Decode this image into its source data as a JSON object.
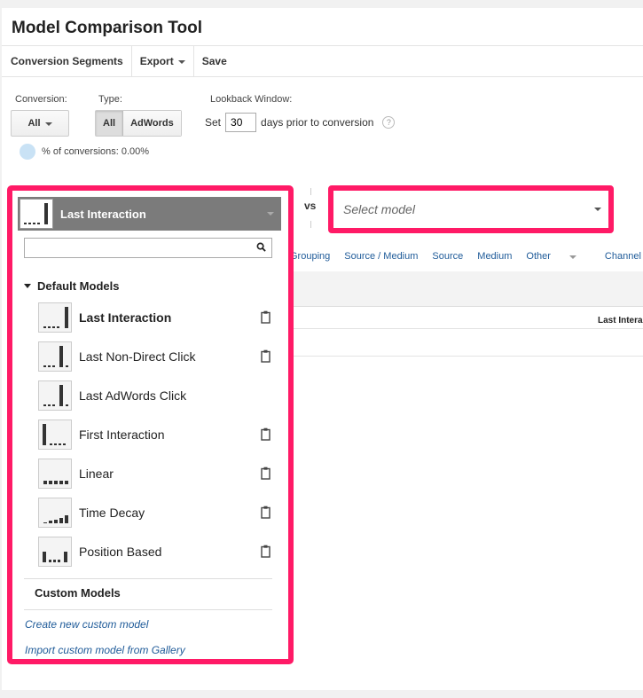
{
  "app": {
    "title": "Model Comparison Tool"
  },
  "toolbar": {
    "conversion_segments": "Conversion Segments",
    "export": "Export",
    "save": "Save"
  },
  "filters": {
    "conversion_label": "Conversion:",
    "conversion_value": "All",
    "type_label": "Type:",
    "type_all": "All",
    "type_adwords": "AdWords",
    "lookback_label": "Lookback Window:",
    "lookback_set": "Set",
    "lookback_days": "30",
    "lookback_suffix": "days prior to conversion",
    "help": "?",
    "pct_conversions": "% of conversions: 0.00%"
  },
  "compare": {
    "vs": "vs",
    "select_placeholder": "Select model"
  },
  "dimension_links": [
    "Grouping",
    "Source / Medium",
    "Source",
    "Medium",
    "Other",
    "Channel Grou"
  ],
  "table": {
    "col_head": "Last Intera"
  },
  "dropdown": {
    "selected": "Last Interaction",
    "default_title": "Default Models",
    "models": [
      {
        "label": "Last Interaction",
        "icon": "last-interaction-icon",
        "copy": true
      },
      {
        "label": "Last Non-Direct Click",
        "icon": "last-non-direct-click-icon",
        "copy": true
      },
      {
        "label": "Last AdWords Click",
        "icon": "last-adwords-click-icon",
        "copy": false
      },
      {
        "label": "First Interaction",
        "icon": "first-interaction-icon",
        "copy": true
      },
      {
        "label": "Linear",
        "icon": "linear-icon",
        "copy": true
      },
      {
        "label": "Time Decay",
        "icon": "time-decay-icon",
        "copy": true
      },
      {
        "label": "Position Based",
        "icon": "position-based-icon",
        "copy": true
      }
    ],
    "custom_title": "Custom Models",
    "create_link": "Create new custom model",
    "import_link": "Import custom model from Gallery"
  },
  "colors": {
    "highlight": "#ff1a66",
    "link": "#1f5b99",
    "header_bg": "#7b7b7b"
  }
}
